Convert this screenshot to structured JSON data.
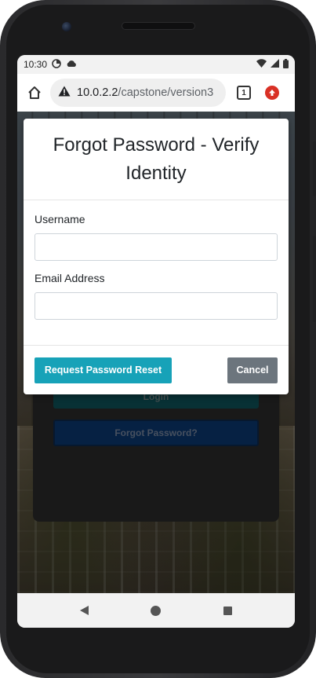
{
  "status_bar": {
    "time": "10:30"
  },
  "browser": {
    "url_host": "10.0.2.2",
    "url_path": "/capstone/version3",
    "tab_count": "1"
  },
  "background_page": {
    "login_label": "Login",
    "forgot_label": "Forgot Password?"
  },
  "modal": {
    "title": "Forgot Password - Verify Identity",
    "username_label": "Username",
    "username_value": "",
    "email_label": "Email Address",
    "email_value": "",
    "reset_button": "Request Password Reset",
    "cancel_button": "Cancel"
  },
  "colors": {
    "reset_button": "#17a2b8",
    "cancel_button": "#6c757d"
  },
  "icons": {
    "status": [
      "data-saver-icon",
      "cloud-icon",
      "wifi-icon",
      "signal-icon",
      "battery-icon"
    ],
    "browser": [
      "home-icon",
      "warning-icon",
      "tabs-icon",
      "update-icon"
    ],
    "nav": [
      "back-icon",
      "home-nav-icon",
      "recents-icon"
    ]
  }
}
